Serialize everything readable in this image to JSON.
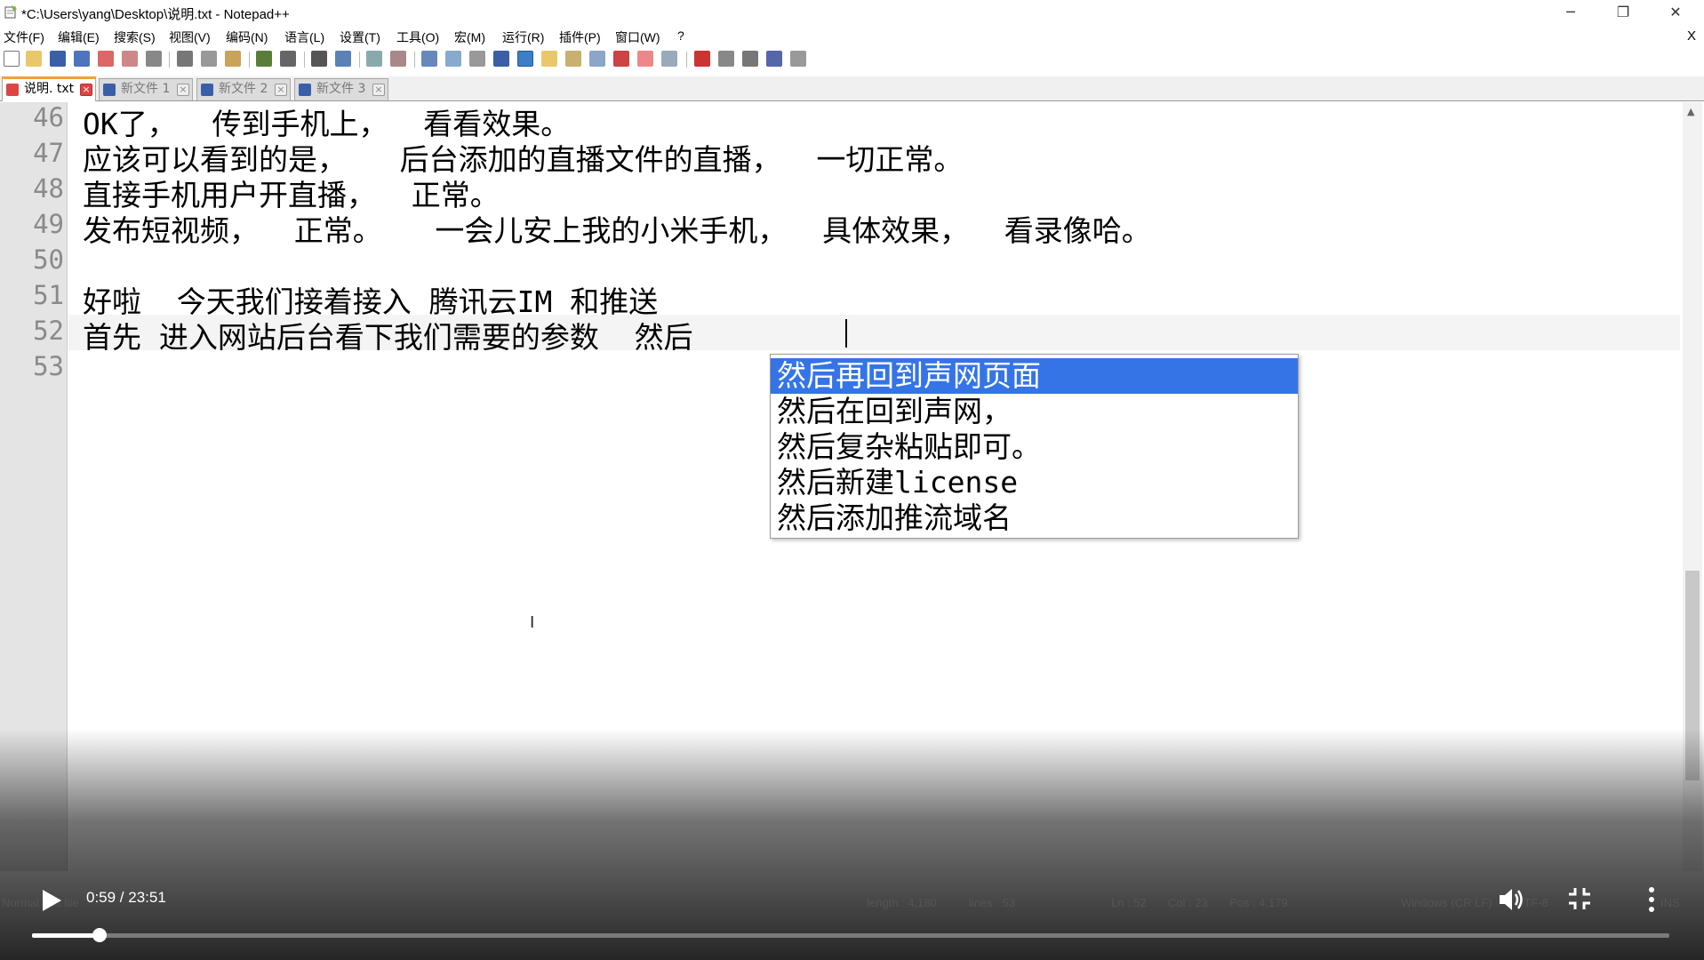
{
  "window": {
    "title": "*C:\\Users\\yang\\Desktop\\说明.txt - Notepad++",
    "min_glyph": "─",
    "max_glyph": "❐",
    "close_glyph": "✕"
  },
  "menu": {
    "items": [
      "文件(F)",
      "编辑(E)",
      "搜索(S)",
      "视图(V)",
      "编码(N)",
      "语言(L)",
      "设置(T)",
      "工具(O)",
      "宏(M)",
      "运行(R)",
      "插件(P)",
      "窗口(W)",
      "?"
    ],
    "close_label": "X"
  },
  "tabs": [
    {
      "label": "说明. txt",
      "active": true
    },
    {
      "label": "新文件 1",
      "active": false
    },
    {
      "label": "新文件 2",
      "active": false
    },
    {
      "label": "新文件 3",
      "active": false
    }
  ],
  "editor": {
    "lines": [
      {
        "num": "46",
        "text": "OK了，  传到手机上，  看看效果。"
      },
      {
        "num": "47",
        "text": "应该可以看到的是，   后台添加的直播文件的直播，  一切正常。"
      },
      {
        "num": "48",
        "text": "直接手机用户开直播，  正常。"
      },
      {
        "num": "49",
        "text": "发布短视频，  正常。   一会儿安上我的小米手机，  具体效果，  看录像哈。"
      },
      {
        "num": "50",
        "text": ""
      },
      {
        "num": "51",
        "text": "好啦  今天我们接着接入 腾讯云IM 和推送"
      },
      {
        "num": "52",
        "text": "首先 进入网站后台看下我们需要的参数  然后"
      },
      {
        "num": "53",
        "text": ""
      }
    ],
    "current_line": "52"
  },
  "autocomplete": {
    "items": [
      "然后再回到声网页面",
      "然后在回到声网，",
      "然后复杂粘贴即可。",
      "然后新建license",
      "然后添加推流域名"
    ],
    "selected_index": 0
  },
  "statusbar": {
    "type": "Normal text file",
    "length": "length : 4,180",
    "lines": "lines : 53",
    "ln": "Ln : 52",
    "col": "Col : 23",
    "pos": "Pos : 4,179",
    "eol": "Windows (CR LF)",
    "encoding": "UTF-8",
    "mode": "INS"
  },
  "player": {
    "timecode": "0:59 / 23:51",
    "progress_fraction": 0.0412
  },
  "colors": {
    "selection": "#3474e6",
    "gutter": "#e4e4e4",
    "active_tab_accent": "#f8a030"
  }
}
